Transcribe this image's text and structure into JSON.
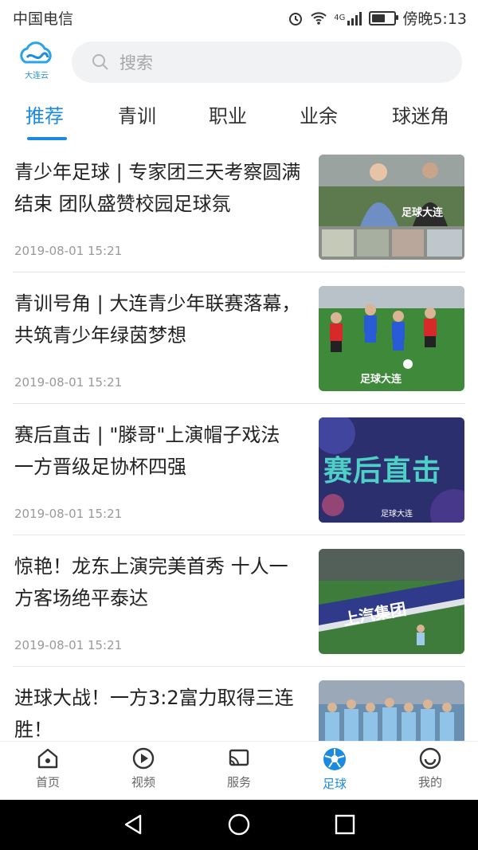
{
  "status_bar": {
    "carrier": "中国电信",
    "time": "傍晚5:13",
    "network": "4G"
  },
  "header": {
    "logo_text": "大连云",
    "search_placeholder": "搜索"
  },
  "tabs": [
    {
      "label": "推荐",
      "active": true
    },
    {
      "label": "青训"
    },
    {
      "label": "职业"
    },
    {
      "label": "业余"
    },
    {
      "label": "球迷角"
    }
  ],
  "articles": [
    {
      "title": "青少年足球 | 专家团三天考察圆满结束 团队盛赞校园足球氛",
      "time": "2019-08-01 15:21",
      "thumb_caption": "足球大连"
    },
    {
      "title": "青训号角 | 大连青少年联赛落幕，共筑青少年绿茵梦想",
      "time": "2019-08-01 15:21",
      "thumb_caption": "足球大连"
    },
    {
      "title": "赛后直击 | \"滕哥\"上演帽子戏法 一方晋级足协杯四强",
      "time": "2019-08-01 15:21",
      "thumb_caption": "赛后直击",
      "thumb_sub": "足球大连"
    },
    {
      "title": "惊艳！龙东上演完美首秀 十人一方客场绝平泰达",
      "time": "2019-08-01 15:21",
      "thumb_caption": "上汽集团"
    },
    {
      "title": "进球大战！一方3:2富力取得三连胜！",
      "time": ""
    }
  ],
  "bottom_nav": [
    {
      "label": "首页",
      "icon": "home-icon"
    },
    {
      "label": "视频",
      "icon": "play-icon"
    },
    {
      "label": "服务",
      "icon": "cast-icon"
    },
    {
      "label": "足球",
      "icon": "football-icon",
      "active": true
    },
    {
      "label": "我的",
      "icon": "smile-icon"
    }
  ],
  "colors": {
    "accent": "#1a8be0",
    "text": "#222222",
    "muted": "#999999"
  }
}
